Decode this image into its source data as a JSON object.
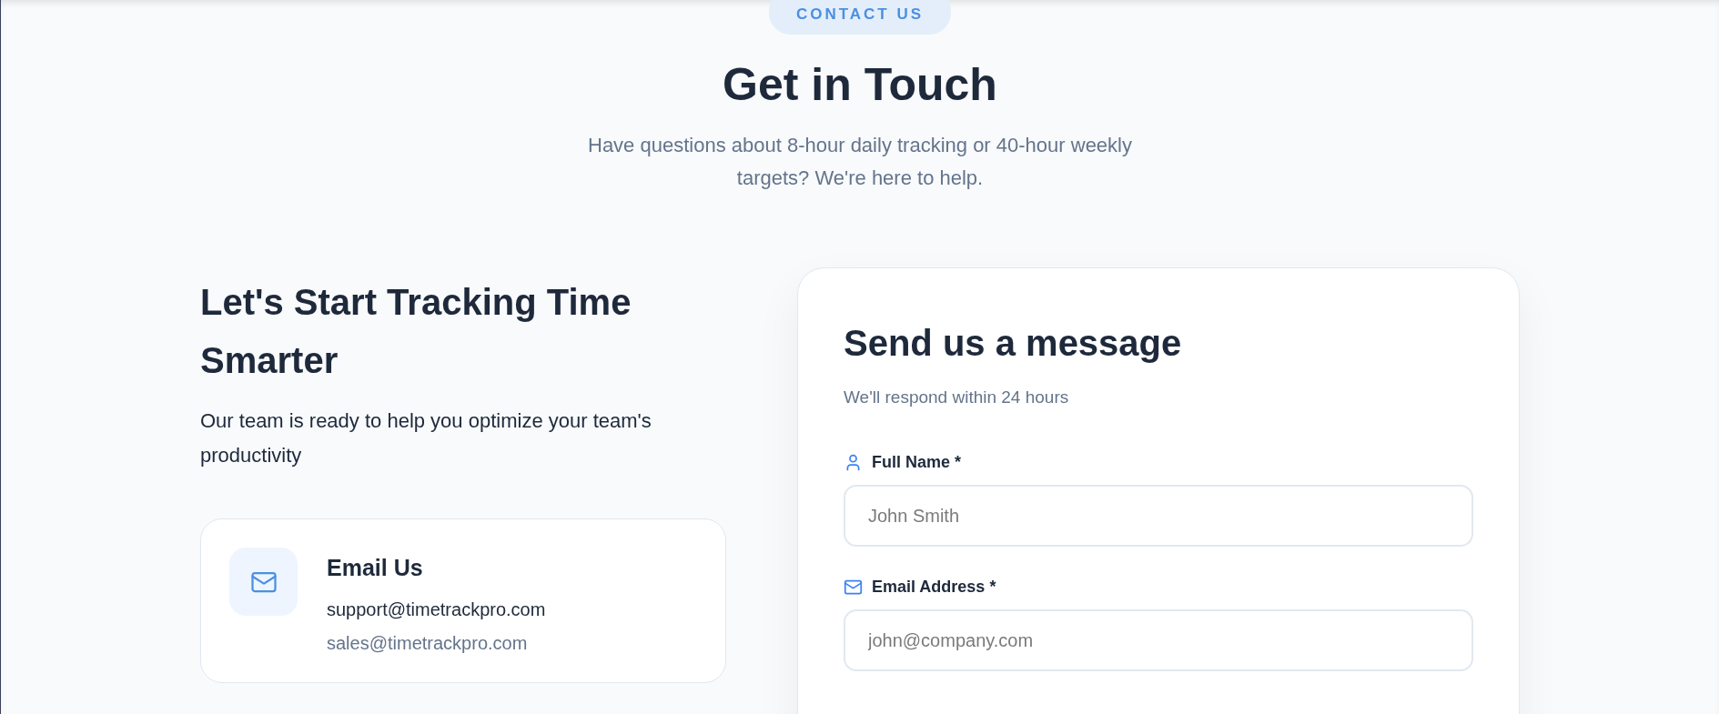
{
  "badge": "CONTACT US",
  "title": "Get in Touch",
  "subtitle": "Have questions about 8-hour daily tracking or 40-hour weekly targets? We're here to help.",
  "info": {
    "heading": "Let's Start Tracking Time Smarter",
    "text": "Our team is ready to help you optimize your team's productivity",
    "cards": [
      {
        "kind": "email",
        "title": "Email Us",
        "lines": [
          "support@timetrackpro.com",
          "sales@timetrackpro.com"
        ]
      }
    ]
  },
  "form": {
    "title": "Send us a message",
    "subtitle": "We'll respond within 24 hours",
    "fields": [
      {
        "kind": "person",
        "label": "Full Name *",
        "placeholder": "John Smith"
      },
      {
        "kind": "email",
        "label": "Email Address *",
        "placeholder": "john@company.com"
      }
    ]
  }
}
